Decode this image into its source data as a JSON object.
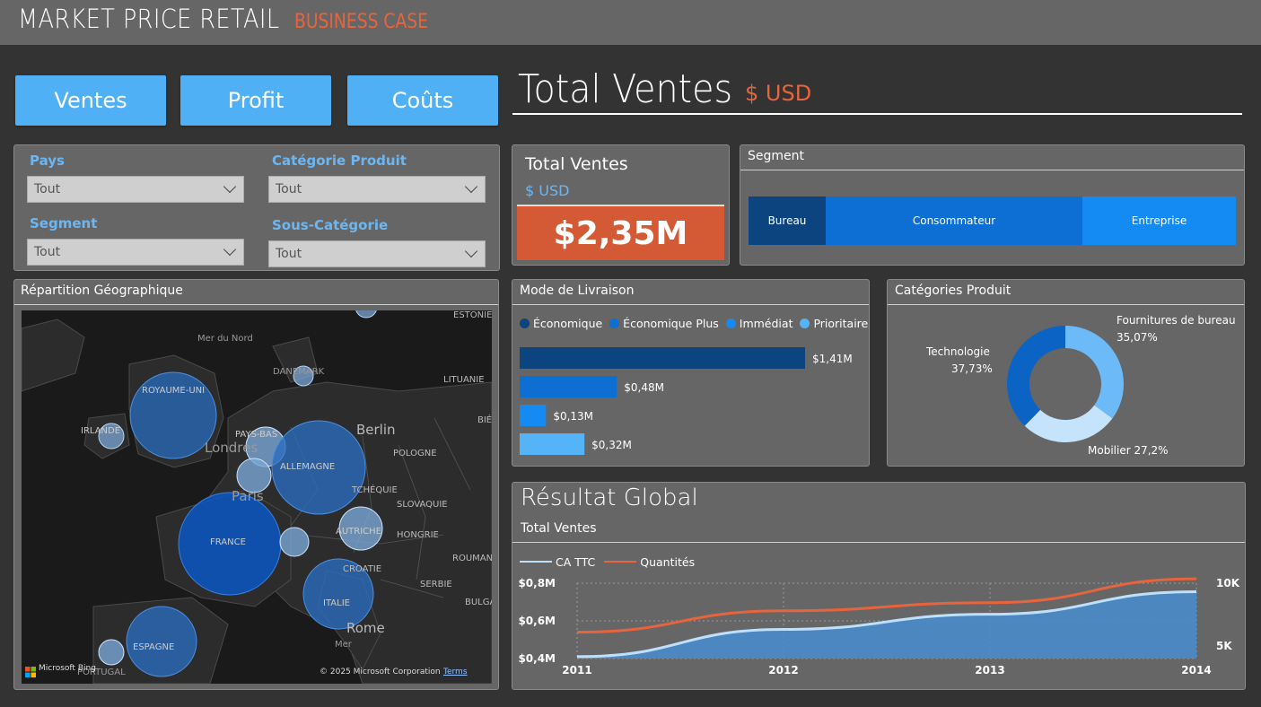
{
  "header": {
    "title": "MARKET PRICE RETAIL",
    "subtitle": "BUSINESS CASE"
  },
  "nav": {
    "ventes": "Ventes",
    "profit": "Profit",
    "couts": "Coûts"
  },
  "page": {
    "title": "Total Ventes",
    "unit": "$ USD"
  },
  "filters": {
    "pays": {
      "label": "Pays",
      "value": "Tout"
    },
    "categorie": {
      "label": "Catégorie Produit",
      "value": "Tout"
    },
    "segment": {
      "label": "Segment",
      "value": "Tout"
    },
    "sous_categorie": {
      "label": "Sous-Catégorie",
      "value": "Tout"
    }
  },
  "kpi": {
    "title": "Total Ventes",
    "unit": "$ USD",
    "value": "$2,35M",
    "accent": "#d35a35"
  },
  "segment": {
    "title": "Segment",
    "items": [
      {
        "label": "Bureau",
        "color": "#0c447f"
      },
      {
        "label": "Consommateur",
        "color": "#0d6fd4"
      },
      {
        "label": "Entreprise",
        "color": "#148bf2"
      }
    ]
  },
  "map": {
    "title": "Répartition Géographique",
    "labels": {
      "mer_du_nord": "Mer du Nord",
      "danemark": "DANEMARK",
      "estonie": "ESTONIE",
      "lituanie": "LITUANIE",
      "royaume_uni": "ROYAUME-UNI",
      "irlande": "IRLANDE",
      "londres": "Londres",
      "pays_bas": "PAYS-BAS",
      "berlin": "Berlin",
      "pologne": "POLOGNE",
      "allemagne": "ALLEMAGNE",
      "tchequie": "TCHÉQUIE",
      "paris": "Paris",
      "slovaquie": "SLOVAQUIE",
      "france": "FRANCE",
      "autriche": "AUTRICHE",
      "hongrie": "HONGRIE",
      "croatie": "CROATIE",
      "roumanie": "ROUMAN",
      "serbie": "SERBIE",
      "italie": "ITALIE",
      "bulgarie": "BULGA",
      "rome": "Rome",
      "espagne": "ESPAGNE",
      "mer": "Mer",
      "portugal": "PORTUGAL",
      "bi": "BIÉ"
    },
    "bing": "Microsoft Bing",
    "copyright": "© 2025 Microsoft Corporation",
    "terms": "Terms"
  },
  "shipping": {
    "title": "Mode de Livraison",
    "legend": [
      {
        "label": "Économique",
        "color": "#0c447f"
      },
      {
        "label": "Économique Plus",
        "color": "#0d6fd4"
      },
      {
        "label": "Immédiat",
        "color": "#148bf2"
      },
      {
        "label": "Prioritaire",
        "color": "#55b3f8"
      }
    ]
  },
  "categories": {
    "title": "Catégories Produit",
    "labels": {
      "fournitures": "Fournitures de bureau",
      "fournitures_pct": "35,07%",
      "technologie": "Technologie",
      "technologie_pct": "37,73%",
      "mobilier": "Mobilier 27,2%"
    }
  },
  "global": {
    "title": "Résultat Global",
    "subtitle": "Total Ventes",
    "legend": [
      {
        "label": "CA TTC",
        "color": "#bfe0fb"
      },
      {
        "label": "Quantités",
        "color": "#e8643c"
      }
    ]
  },
  "chart_data": [
    {
      "type": "bar",
      "orientation": "horizontal",
      "categories": [
        "Économique",
        "Économique Plus",
        "Immédiat",
        "Prioritaire"
      ],
      "values": [
        1.41,
        0.48,
        0.13,
        0.32
      ],
      "value_labels": [
        "$1,41M",
        "$0,48M",
        "$0,13M",
        "$0,32M"
      ],
      "colors": [
        "#0c447f",
        "#0d6fd4",
        "#148bf2",
        "#55b3f8"
      ],
      "legend": "top"
    },
    {
      "type": "pie",
      "donut": true,
      "labels": [
        "Fournitures de bureau",
        "Mobilier",
        "Technologie"
      ],
      "values": [
        35.07,
        27.2,
        37.73
      ],
      "colors": [
        "#6cbaf7",
        "#c5e3fb",
        "#0b63c4"
      ]
    },
    {
      "type": "area",
      "x": [
        "2011",
        "2012",
        "2013",
        "2014"
      ],
      "series": [
        {
          "name": "CA TTC",
          "values": [
            0.41,
            0.555,
            0.635,
            0.755
          ],
          "axis": "left",
          "color": "#bfe0fb",
          "fill": "#4a8bc9"
        },
        {
          "name": "Quantités",
          "values": [
            6100,
            7800,
            8450,
            10350
          ],
          "axis": "right",
          "color": "#e8643c"
        }
      ],
      "y_left_ticks": [
        "$0,4M",
        "$0,6M",
        "$0,8M"
      ],
      "ylim_left": [
        0.4,
        0.8
      ],
      "y_right_ticks": [
        "5K",
        "10K"
      ],
      "ylim_right": [
        4000,
        10000
      ],
      "grid": true,
      "legend": "top-left"
    }
  ]
}
